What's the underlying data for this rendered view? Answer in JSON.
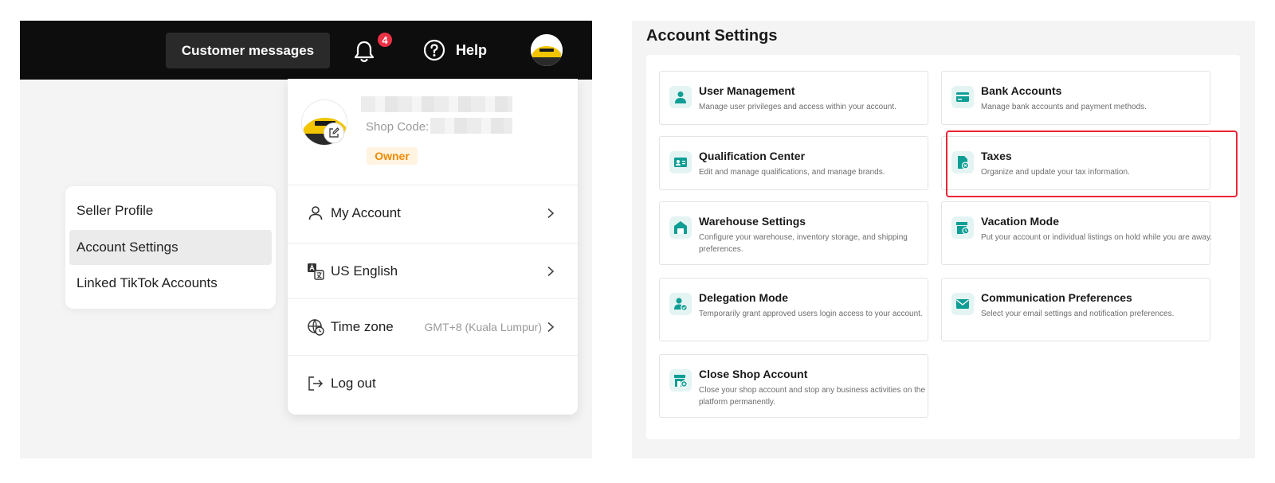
{
  "left": {
    "topbar": {
      "customer_messages": "Customer messages",
      "notification_count": "4",
      "help_label": "Help"
    },
    "seller_menu": {
      "items": [
        {
          "label": "Seller Profile"
        },
        {
          "label": "Account Settings"
        },
        {
          "label": "Linked TikTok Accounts"
        }
      ],
      "active_index": 1
    },
    "account_dropdown": {
      "shop_code_label": "Shop Code:",
      "role_badge": "Owner",
      "my_account": "My Account",
      "language": "US English",
      "timezone_label": "Time zone",
      "timezone_value": "GMT+8 (Kuala Lumpur)",
      "logout": "Log out"
    }
  },
  "right": {
    "title": "Account Settings",
    "tiles": [
      {
        "title": "User Management",
        "desc": "Manage user privileges and access within your account.",
        "icon": "user-icon"
      },
      {
        "title": "Bank Accounts",
        "desc": "Manage bank accounts and payment methods.",
        "icon": "card-icon"
      },
      {
        "title": "Qualification Center",
        "desc": "Edit and manage qualifications, and manage brands.",
        "icon": "id-card-icon"
      },
      {
        "title": "Taxes",
        "desc": "Organize and update your tax information.",
        "icon": "tax-document-icon"
      },
      {
        "title": "Warehouse Settings",
        "desc": "Configure your warehouse, inventory storage, and shipping preferences.",
        "icon": "warehouse-icon"
      },
      {
        "title": "Vacation Mode",
        "desc": "Put your account or individual listings on hold while you are away.",
        "icon": "store-clock-icon"
      },
      {
        "title": "Delegation Mode",
        "desc": "Temporarily grant approved users login access to your account.",
        "icon": "user-check-icon"
      },
      {
        "title": "Communication Preferences",
        "desc": "Select your email settings and notification preferences.",
        "icon": "mail-icon"
      },
      {
        "title": "Close Shop Account",
        "desc": "Close your shop account and stop any business activities on the platform permanently.",
        "icon": "store-close-icon"
      }
    ],
    "highlighted_tile": "Taxes"
  },
  "colors": {
    "accent_teal": "#0e9e95",
    "teal_tint": "#e3f4f3",
    "highlight_red": "#ee2436",
    "badge_red": "#ee3045",
    "owner_orange": "#f08a00"
  }
}
